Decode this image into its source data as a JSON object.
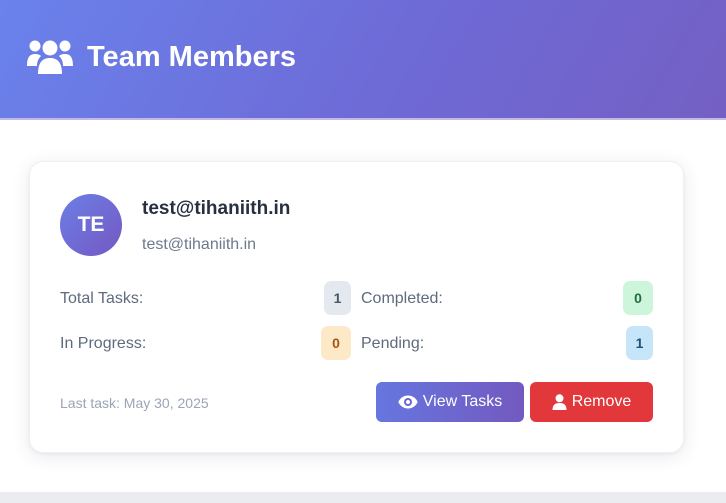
{
  "header": {
    "icon": "users-icon",
    "title": "Team Members"
  },
  "member": {
    "initials": "TE",
    "name": "test@tihaniith.in",
    "email": "test@tihaniith.in",
    "stats": {
      "total_label": "Total Tasks:",
      "total_value": "1",
      "completed_label": "Completed:",
      "completed_value": "0",
      "in_progress_label": "In Progress:",
      "in_progress_value": "0",
      "pending_label": "Pending:",
      "pending_value": "1"
    },
    "last_task": "Last task: May 30, 2025",
    "actions": {
      "view_label": "View Tasks",
      "view_icon": "eye-icon",
      "remove_label": "Remove",
      "remove_icon": "user-icon"
    }
  },
  "colors": {
    "header_start": "#6a82ec",
    "header_end": "#7460c4",
    "remove": "#e2383c",
    "completed_badge": "#cdf5db",
    "progress_badge": "#fde9c7",
    "pending_badge": "#c7e5f8",
    "total_badge": "#e4e9f0"
  }
}
